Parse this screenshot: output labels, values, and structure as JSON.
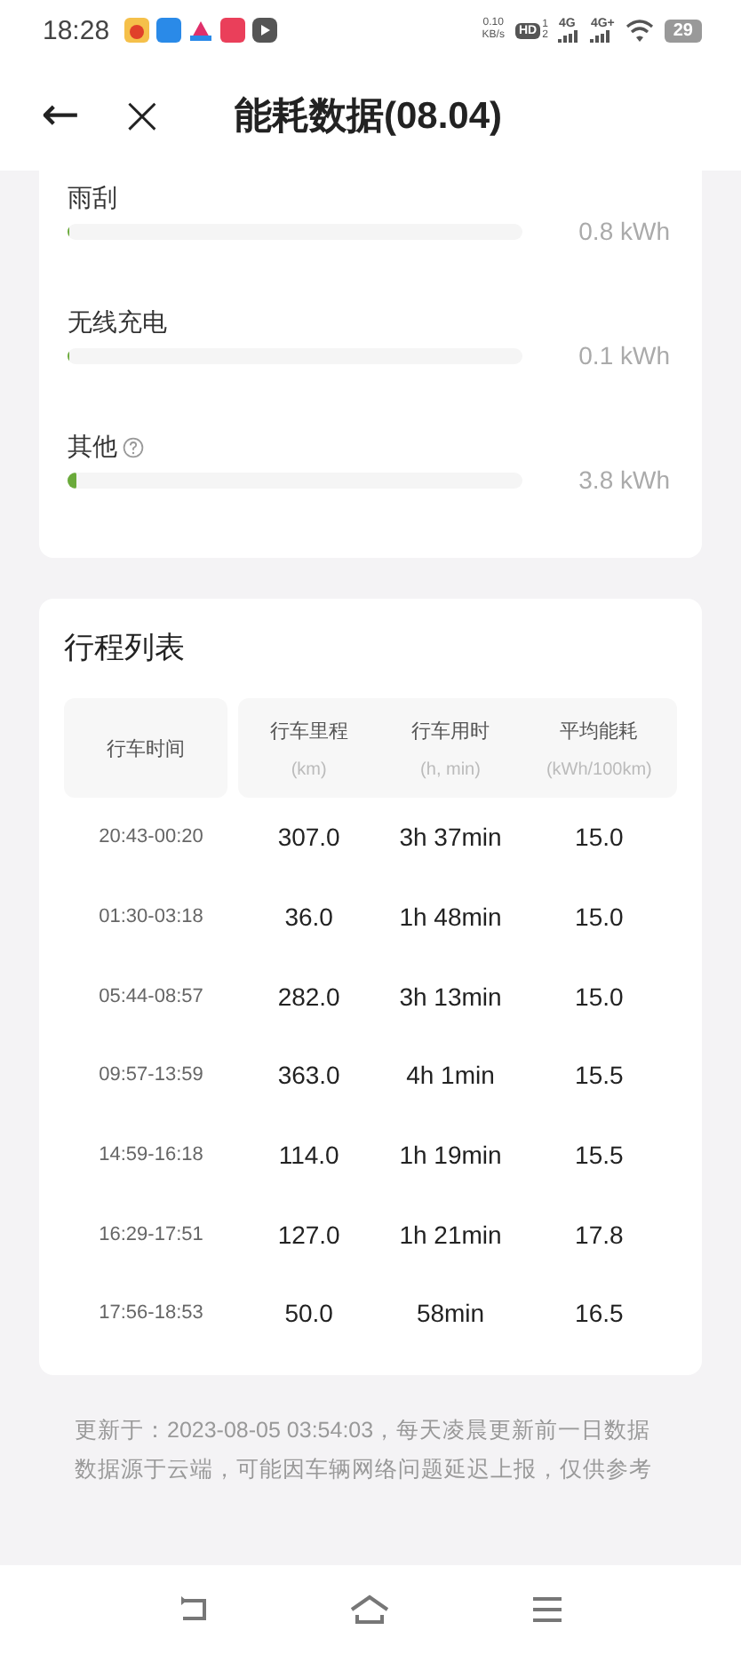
{
  "status_bar": {
    "time": "18:28",
    "net_speed": "0.10",
    "net_unit": "KB/s",
    "hd": "HD",
    "sim_1": "1",
    "sim_2": "2",
    "network_1": "4G",
    "network_2": "4G+",
    "battery": "29"
  },
  "header": {
    "back": "←",
    "close": "×",
    "title": "能耗数据(08.04)"
  },
  "consumers": [
    {
      "kind": "plain",
      "name": "雨刮",
      "level": 0.004,
      "value": "0.8 kWh"
    },
    {
      "kind": "plain",
      "name": "无线充电",
      "level": 0.002,
      "value": "0.1 kWh"
    },
    {
      "kind": "with_help",
      "name": "其他",
      "level": 0.018,
      "value": "3.8 kWh"
    }
  ],
  "trips": {
    "title": "行程列表",
    "columns": [
      {
        "label": "行车时间"
      },
      {
        "label": "行车里程",
        "unit": "(km)"
      },
      {
        "label": "行车用时",
        "unit": "(h, min)"
      },
      {
        "label": "平均能耗",
        "unit": "(kWh/100km)"
      }
    ],
    "rows": [
      [
        "20:43-00:20",
        "307.0",
        "3h 37min",
        "15.0"
      ],
      [
        "01:30-03:18",
        "36.0",
        "1h 48min",
        "15.0"
      ],
      [
        "05:44-08:57",
        "282.0",
        "3h 13min",
        "15.0"
      ],
      [
        "09:57-13:59",
        "363.0",
        "4h 1min",
        "15.5"
      ],
      [
        "14:59-16:18",
        "114.0",
        "1h 19min",
        "15.5"
      ],
      [
        "16:29-17:51",
        "127.0",
        "1h 21min",
        "17.8"
      ],
      [
        "17:56-18:53",
        "50.0",
        "58min",
        "16.5"
      ]
    ]
  },
  "footer": [
    "更新于：2023-08-05 03:54:03，每天凌晨更新前一日数据",
    "数据源于云端，可能因车辆网络问题延迟上报，仅供参考"
  ]
}
